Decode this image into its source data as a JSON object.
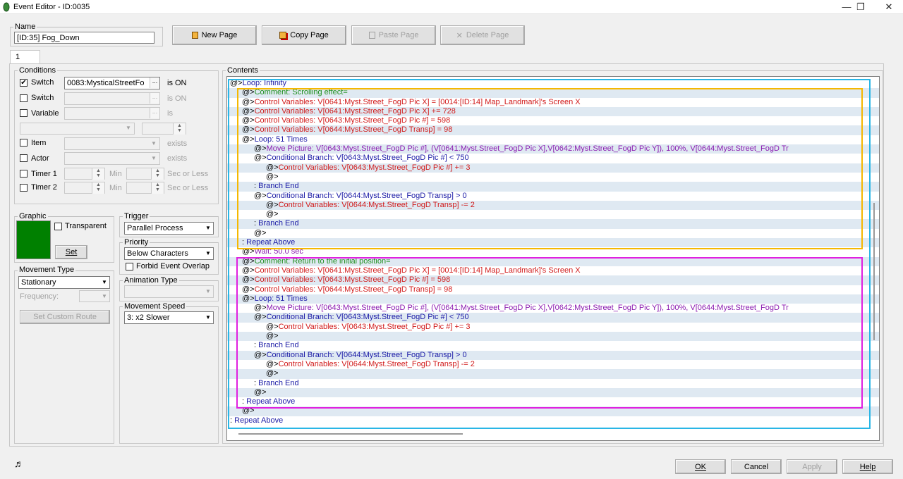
{
  "window": {
    "title": "Event Editor - ID:0035",
    "minimize": "—",
    "restore": "❐",
    "close": "✕"
  },
  "name_group": {
    "label": "Name",
    "value": "[ID:35] Fog_Down"
  },
  "toolbar": {
    "new_page": "New Page",
    "copy_page": "Copy Page",
    "paste_page": "Paste Page",
    "delete_page": "Delete Page"
  },
  "page_tab": "1",
  "conditions": {
    "label": "Conditions",
    "switch1": {
      "label": "Switch",
      "value": "0083:MysticalStreetFo",
      "suffix": "is ON",
      "checked": "✔"
    },
    "switch2": {
      "label": "Switch",
      "suffix": "is ON"
    },
    "variable": {
      "label": "Variable",
      "suffix": "is"
    },
    "item": {
      "label": "Item",
      "suffix": "exists"
    },
    "actor": {
      "label": "Actor",
      "suffix": "exists"
    },
    "timer1": {
      "label": "Timer 1",
      "min": "Min",
      "suffix": "Sec or Less"
    },
    "timer2": {
      "label": "Timer 2",
      "min": "Min",
      "suffix": "Sec or Less"
    }
  },
  "graphic": {
    "label": "Graphic",
    "transparent": "Transparent",
    "set": "Set",
    "color": "#008000"
  },
  "trigger": {
    "label": "Trigger",
    "value": "Parallel Process"
  },
  "priority": {
    "label": "Priority",
    "value": "Below Characters",
    "forbid": "Forbid Event Overlap"
  },
  "movement_type": {
    "label": "Movement Type",
    "value": "Stationary",
    "frequency": "Frequency:",
    "custom_route": "Set Custom Route"
  },
  "animation_type": {
    "label": "Animation Type"
  },
  "movement_speed": {
    "label": "Movement Speed",
    "value": "3: x2 Slower"
  },
  "contents": {
    "label": "Contents",
    "lines": [
      {
        "indent": 0,
        "prefix": "@>",
        "kind": "loop",
        "text": "Loop: Infinity"
      },
      {
        "indent": 1,
        "prefix": "@>",
        "kind": "comment",
        "text": "Comment: Scrolling effect="
      },
      {
        "indent": 1,
        "prefix": "@>",
        "kind": "var",
        "text": "Control Variables: V[0641:Myst.Street_FogD Pic X] = [0014:[ID:14] Map_Landmark]'s Screen X"
      },
      {
        "indent": 1,
        "prefix": "@>",
        "kind": "var",
        "text": "Control Variables: V[0641:Myst.Street_FogD Pic X] += 728"
      },
      {
        "indent": 1,
        "prefix": "@>",
        "kind": "var",
        "text": "Control Variables: V[0643:Myst.Street_FogD Pic #] = 598"
      },
      {
        "indent": 1,
        "prefix": "@>",
        "kind": "var",
        "text": "Control Variables: V[0644:Myst.Street_FogD Transp] = 98"
      },
      {
        "indent": 1,
        "prefix": "@>",
        "kind": "loop",
        "text": "Loop: 51 Times"
      },
      {
        "indent": 2,
        "prefix": "@>",
        "kind": "move",
        "text": "Move Picture: V[0643:Myst.Street_FogD Pic #], (V[0641:Myst.Street_FogD Pic X],V[0642:Myst.Street_FogD Pic Y]), 100%, V[0644:Myst.Street_FogD Tr"
      },
      {
        "indent": 2,
        "prefix": "@>",
        "kind": "cond",
        "text": "Conditional Branch: V[0643:Myst.Street_FogD Pic #] < 750"
      },
      {
        "indent": 3,
        "prefix": "@>",
        "kind": "var",
        "text": "Control Variables: V[0643:Myst.Street_FogD Pic #] += 3"
      },
      {
        "indent": 3,
        "prefix": "@>",
        "kind": "end",
        "text": ""
      },
      {
        "indent": 2,
        "prefix": " : ",
        "kind": "end",
        "text": "Branch End"
      },
      {
        "indent": 2,
        "prefix": "@>",
        "kind": "cond",
        "text": "Conditional Branch: V[0644:Myst.Street_FogD Transp] > 0"
      },
      {
        "indent": 3,
        "prefix": "@>",
        "kind": "var",
        "text": "Control Variables: V[0644:Myst.Street_FogD Transp] -= 2"
      },
      {
        "indent": 3,
        "prefix": "@>",
        "kind": "end",
        "text": ""
      },
      {
        "indent": 2,
        "prefix": " : ",
        "kind": "end",
        "text": "Branch End"
      },
      {
        "indent": 2,
        "prefix": "@>",
        "kind": "end",
        "text": ""
      },
      {
        "indent": 1,
        "prefix": " : ",
        "kind": "end",
        "text": "Repeat Above"
      },
      {
        "indent": 1,
        "prefix": "@>",
        "kind": "wait",
        "text": "Wait: 50.0 sec"
      },
      {
        "indent": 1,
        "prefix": "@>",
        "kind": "comment",
        "text": "Comment: Return to the initial position="
      },
      {
        "indent": 1,
        "prefix": "@>",
        "kind": "var",
        "text": "Control Variables: V[0641:Myst.Street_FogD Pic X] = [0014:[ID:14] Map_Landmark]'s Screen X"
      },
      {
        "indent": 1,
        "prefix": "@>",
        "kind": "var",
        "text": "Control Variables: V[0643:Myst.Street_FogD Pic #] = 598"
      },
      {
        "indent": 1,
        "prefix": "@>",
        "kind": "var",
        "text": "Control Variables: V[0644:Myst.Street_FogD Transp] = 98"
      },
      {
        "indent": 1,
        "prefix": "@>",
        "kind": "loop",
        "text": "Loop: 51 Times"
      },
      {
        "indent": 2,
        "prefix": "@>",
        "kind": "move",
        "text": "Move Picture: V[0643:Myst.Street_FogD Pic #], (V[0641:Myst.Street_FogD Pic X],V[0642:Myst.Street_FogD Pic Y]), 100%, V[0644:Myst.Street_FogD Tr"
      },
      {
        "indent": 2,
        "prefix": "@>",
        "kind": "cond",
        "text": "Conditional Branch: V[0643:Myst.Street_FogD Pic #] < 750"
      },
      {
        "indent": 3,
        "prefix": "@>",
        "kind": "var",
        "text": "Control Variables: V[0643:Myst.Street_FogD Pic #] += 3"
      },
      {
        "indent": 3,
        "prefix": "@>",
        "kind": "end",
        "text": ""
      },
      {
        "indent": 2,
        "prefix": " : ",
        "kind": "end",
        "text": "Branch End"
      },
      {
        "indent": 2,
        "prefix": "@>",
        "kind": "cond",
        "text": "Conditional Branch: V[0644:Myst.Street_FogD Transp] > 0"
      },
      {
        "indent": 3,
        "prefix": "@>",
        "kind": "var",
        "text": "Control Variables: V[0644:Myst.Street_FogD Transp] -= 2"
      },
      {
        "indent": 3,
        "prefix": "@>",
        "kind": "end",
        "text": ""
      },
      {
        "indent": 2,
        "prefix": " : ",
        "kind": "end",
        "text": "Branch End"
      },
      {
        "indent": 2,
        "prefix": "@>",
        "kind": "end",
        "text": ""
      },
      {
        "indent": 1,
        "prefix": " : ",
        "kind": "end",
        "text": "Repeat Above"
      },
      {
        "indent": 1,
        "prefix": "@>",
        "kind": "end",
        "text": ""
      },
      {
        "indent": 0,
        "prefix": " : ",
        "kind": "end",
        "text": "Repeat Above"
      }
    ]
  },
  "highlights": {
    "outer_color": "#29b6e6",
    "first_color": "#f5b800",
    "second_color": "#e020e0"
  },
  "bottom": {
    "ok": "OK",
    "cancel": "Cancel",
    "apply": "Apply",
    "help": "Help",
    "music_icon": "♬"
  }
}
